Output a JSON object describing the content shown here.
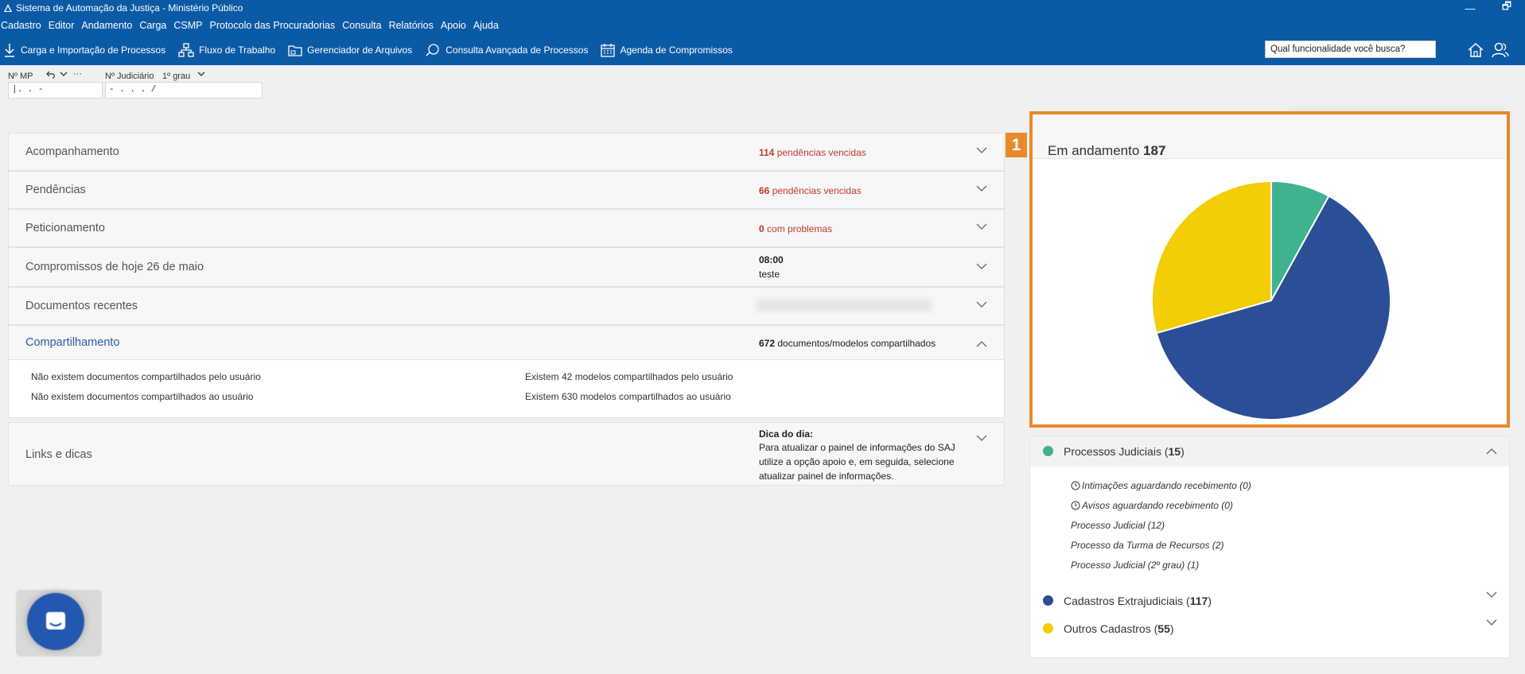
{
  "window": {
    "title": "Sistema de Automação da Justiça - Ministério Público",
    "restore": "🗗",
    "minimize": "—"
  },
  "menu": [
    "Cadastro",
    "Editor",
    "Andamento",
    "Carga",
    "CSMP",
    "Protocolo das Procuradorias",
    "Consulta",
    "Relatórios",
    "Apoio",
    "Ajuda"
  ],
  "toolbar": {
    "items": [
      {
        "label": "Carga e Importação de Processos",
        "icon": "download-icon"
      },
      {
        "label": "Fluxo de Trabalho",
        "icon": "workflow-icon"
      },
      {
        "label": "Gerenciador de Arquivos",
        "icon": "folder-icon"
      },
      {
        "label": "Consulta Avançada de Processos",
        "icon": "search-chat-icon"
      },
      {
        "label": "Agenda de Compromissos",
        "icon": "calendar-icon"
      }
    ],
    "search_value": "Qual funcionalidade você busca?"
  },
  "fields": {
    "mp_label": "Nº MP",
    "mp_value": "|.   .   -",
    "undo_more": "···",
    "judicial_label": "Nº Judiciário",
    "grade": "1º grau",
    "judicial_value": "    -  .  .  .  /"
  },
  "sections": [
    {
      "title": "Acompanhamento",
      "count": "114",
      "status": "pendências vencidas"
    },
    {
      "title": "Pendências",
      "count": "66",
      "status": "pendências vencidas"
    },
    {
      "title": "Peticionamento",
      "count": "0",
      "status": "com problemas"
    },
    {
      "title": "Compromissos de hoje 26 de maio",
      "time": "08:00",
      "note": "teste"
    },
    {
      "title": "Documentos recentes"
    },
    {
      "title": "Compartilhamento",
      "count": "672",
      "status": "documentos/modelos compartilhados"
    },
    {
      "title": "Links e dicas",
      "tip_title": "Dica do dia:",
      "tip_text": [
        "Para atualizar o painel de informações do SAJ",
        "utilize a opção apoio e, em seguida, selecione",
        "atualizar painel de informações."
      ]
    }
  ],
  "sharing": {
    "by_user_docs": "Não existem documentos compartilhados pelo usuário",
    "to_user_docs": "Não existem documentos compartilhados ao usuário",
    "by_user_models": "Existem 42 modelos compartilhados pelo usuário",
    "to_user_models": "Existem 630 modelos compartilhados ao usuário"
  },
  "badge": "1",
  "in_progress": {
    "label": "Em andamento",
    "total": "187"
  },
  "chart_data": {
    "type": "pie",
    "categories": [
      "Processos Judiciais",
      "Cadastros Extrajudiciais",
      "Outros Cadastros"
    ],
    "values": [
      15,
      117,
      55
    ],
    "colors": [
      "#3fb28f",
      "#2a4f97",
      "#f3cd05"
    ]
  },
  "legend": [
    {
      "name": "Processos Judiciais",
      "count": "15",
      "color": "#3fb28f"
    },
    {
      "name": "Cadastros Extrajudiciais",
      "count": "117",
      "color": "#2a4f97"
    },
    {
      "name": "Outros Cadastros",
      "count": "55",
      "color": "#f3cd05"
    }
  ],
  "judicial_items": [
    "Intimações aguardando recebimento (0)",
    "Avisos aguardando recebimento (0)",
    "Processo Judicial (12)",
    "Processo da Turma de Recursos (2)",
    "Processo Judicial (2º grau) (1)"
  ]
}
